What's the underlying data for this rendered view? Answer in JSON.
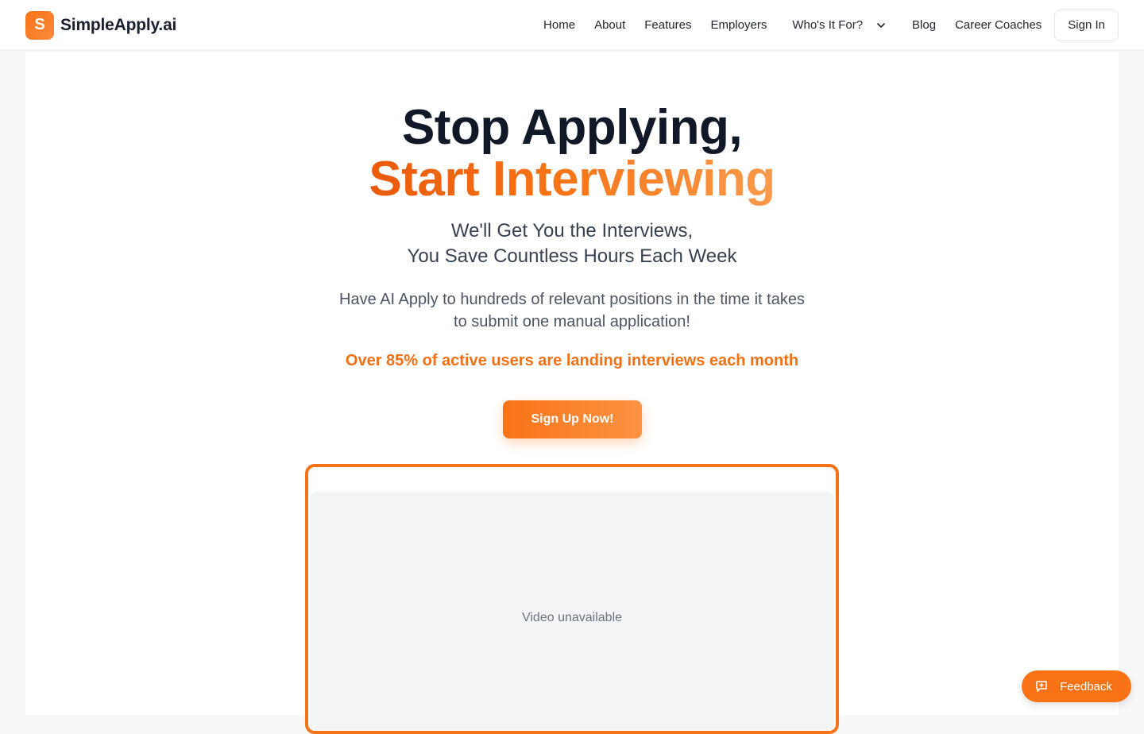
{
  "header": {
    "brand_letter": "S",
    "brand_name": "SimpleApply.ai",
    "nav": {
      "home": "Home",
      "about": "About",
      "features": "Features",
      "employers": "Employers",
      "whos_it_for": "Who's It For?",
      "blog": "Blog",
      "career_coaches": "Career Coaches"
    },
    "sign_in": "Sign In"
  },
  "hero": {
    "title_line1": "Stop Applying,",
    "title_line2": "Start Interviewing",
    "subtitle_line1": "We'll Get You the Interviews,",
    "subtitle_line2": "You Save Countless Hours Each Week",
    "desc_line1": "Have AI Apply to hundreds of relevant positions in the time it takes",
    "desc_line2": "to submit one manual application!",
    "stat": "Over 85% of active users are landing interviews each month",
    "cta": "Sign Up Now!",
    "video_message": "Video unavailable"
  },
  "feedback": {
    "label": "Feedback"
  },
  "colors": {
    "accent": "#f97316",
    "title": "#111827",
    "video_bg": "#f3f4f6"
  },
  "icons": {
    "dropdown": "chevron-down-icon",
    "feedback": "message-plus-icon"
  }
}
